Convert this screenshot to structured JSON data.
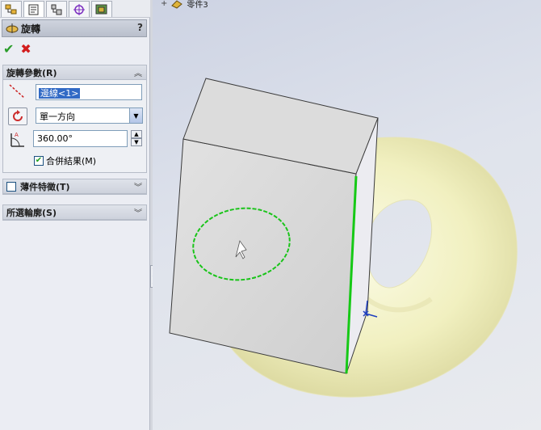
{
  "feature_title": "旋轉",
  "help_label": "?",
  "ok_label": "✔",
  "cancel_label": "✖",
  "tabs": [
    "feature-manager",
    "property-manager",
    "configuration-manager",
    "dimxpert-manager",
    "display-manager"
  ],
  "revolve_params": {
    "heading": "旋轉參數(R)",
    "axis_value": "邊線<1>",
    "direction_value": "單一方向",
    "angle_value": "360.00°",
    "merge_label": "合併結果(M)",
    "merge_checked": true
  },
  "thin_feature": {
    "heading": "薄件特徵(T)",
    "checked": false
  },
  "selected_contours": {
    "heading": "所選輪廓(S)"
  },
  "viewport": {
    "part_name": "零件3"
  },
  "colors": {
    "torus": "#f6f5c8",
    "sketch": "#22cc22",
    "box_face": "#d9d9d9",
    "box_top": "#dedede"
  }
}
